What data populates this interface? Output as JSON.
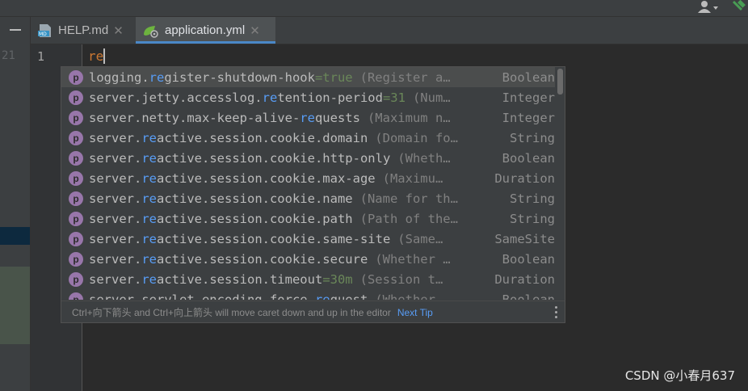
{
  "tabs": [
    {
      "label": "HELP.md",
      "icon": "markdown-file-icon",
      "active": false
    },
    {
      "label": "application.yml",
      "icon": "spring-yaml-file-icon",
      "active": true
    }
  ],
  "gutter": {
    "line_number": "1",
    "partial_number": "21"
  },
  "editor": {
    "typed_text": "re"
  },
  "completion": {
    "items": [
      {
        "badge": "p",
        "pre": "logging.",
        "hl": "re",
        "post": "gister-shutdown-hook",
        "default": "=true",
        "desc": "(Register a…",
        "type": "Boolean"
      },
      {
        "badge": "p",
        "pre": "server.jetty.accesslog.",
        "hl": "re",
        "post": "tention-period",
        "default": "=31",
        "desc": "(Num…",
        "type": "Integer"
      },
      {
        "badge": "p",
        "pre": "server.netty.max-keep-alive-",
        "hl": "re",
        "post": "quests",
        "default": "",
        "desc": "(Maximum n…",
        "type": "Integer"
      },
      {
        "badge": "p",
        "pre": "server.",
        "hl": "re",
        "post": "active.session.cookie.domain",
        "default": "",
        "desc": "(Domain fo…",
        "type": "String"
      },
      {
        "badge": "p",
        "pre": "server.",
        "hl": "re",
        "post": "active.session.cookie.http-only",
        "default": "",
        "desc": "(Wheth…",
        "type": "Boolean"
      },
      {
        "badge": "p",
        "pre": "server.",
        "hl": "re",
        "post": "active.session.cookie.max-age",
        "default": "",
        "desc": "(Maximu…",
        "type": "Duration"
      },
      {
        "badge": "p",
        "pre": "server.",
        "hl": "re",
        "post": "active.session.cookie.name",
        "default": "",
        "desc": "(Name for th…",
        "type": "String"
      },
      {
        "badge": "p",
        "pre": "server.",
        "hl": "re",
        "post": "active.session.cookie.path",
        "default": "",
        "desc": "(Path of the…",
        "type": "String"
      },
      {
        "badge": "p",
        "pre": "server.",
        "hl": "re",
        "post": "active.session.cookie.same-site",
        "default": "",
        "desc": "(Same…",
        "type": "SameSite"
      },
      {
        "badge": "p",
        "pre": "server.",
        "hl": "re",
        "post": "active.session.cookie.secure",
        "default": "",
        "desc": "(Whether …",
        "type": "Boolean"
      },
      {
        "badge": "p",
        "pre": "server.",
        "hl": "re",
        "post": "active.session.timeout",
        "default": "=30m",
        "desc": "(Session t…",
        "type": "Duration"
      },
      {
        "badge": "p",
        "pre": "server.servlet.encoding.force-",
        "hl": "re",
        "post": "quest",
        "default": "",
        "desc": "(Whether…",
        "type": "Boolean"
      }
    ],
    "footer_tip": "Ctrl+向下箭头 and Ctrl+向上箭头 will move caret down and up in the editor",
    "next_tip_label": "Next Tip"
  },
  "watermark": "CSDN @小春月637",
  "colors": {
    "accent": "#4a88c7",
    "highlight": "#589df6",
    "badge": "#9876aa",
    "default_value": "#6a8759"
  }
}
